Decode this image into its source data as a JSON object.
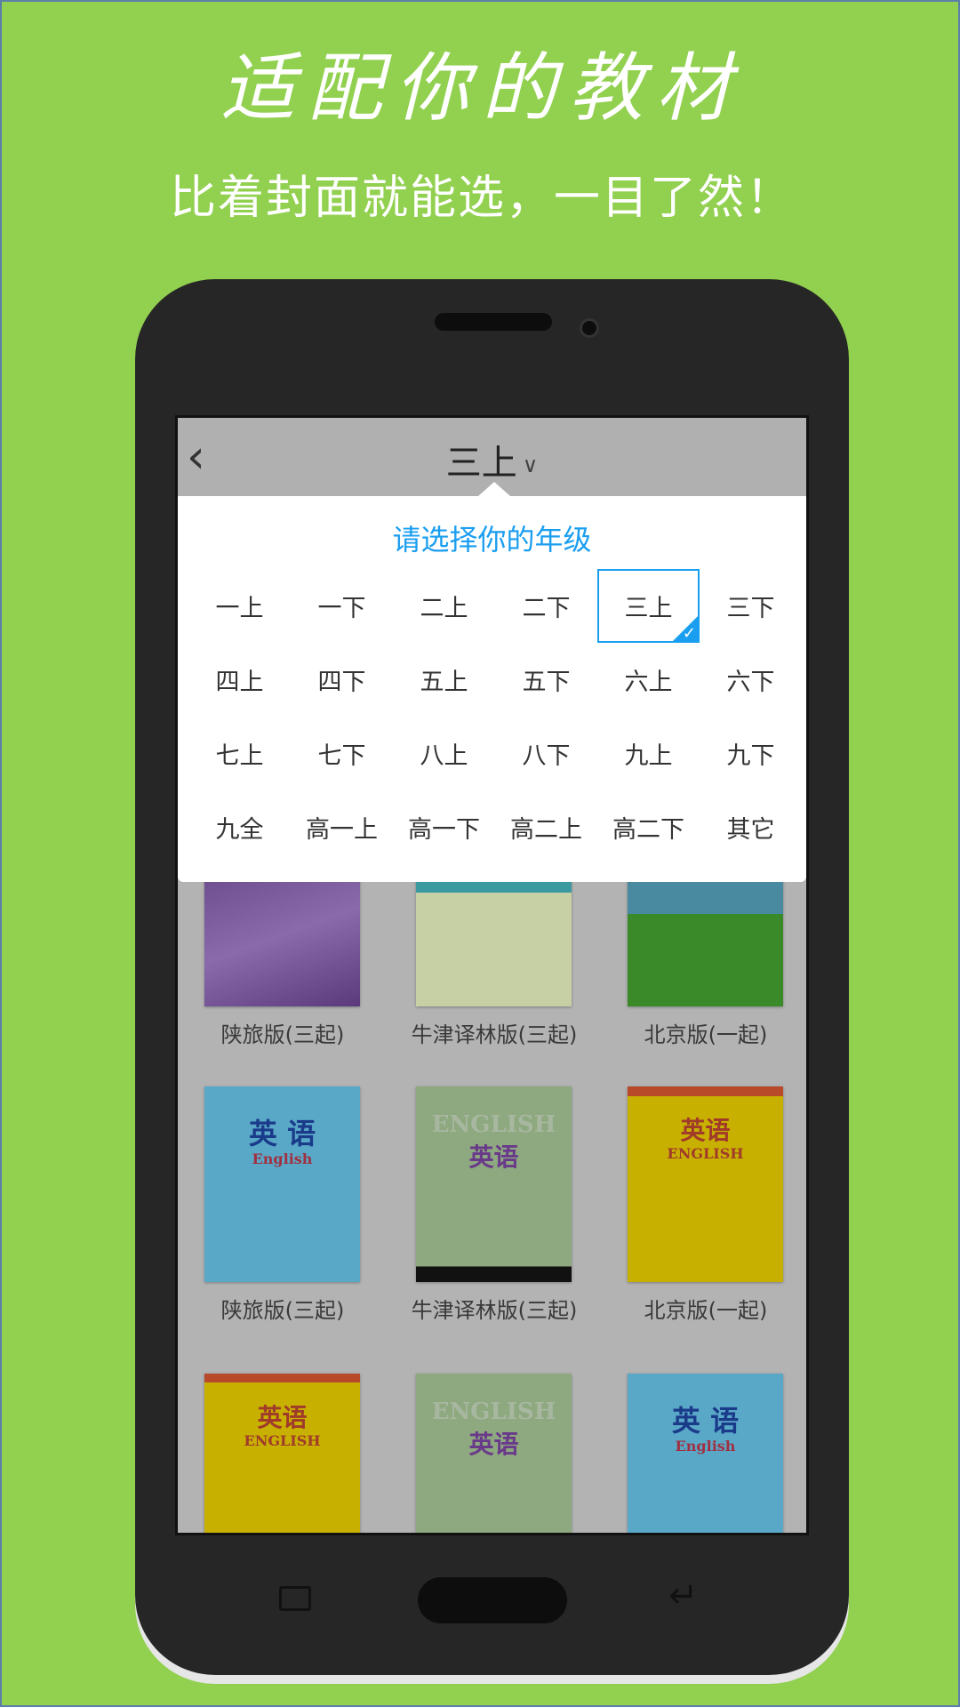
{
  "headline": "适配你的教材",
  "subheadline": "比着封面就能选，一目了然！",
  "app": {
    "back_icon": "chevron-left-icon",
    "current_grade": "三上",
    "dropdown_icon": "chevron-down-icon",
    "panel_title": "请选择你的年级",
    "accent_color": "#1a9ef0",
    "grades": [
      "一上",
      "一下",
      "二上",
      "二下",
      "三上",
      "三下",
      "四上",
      "四下",
      "五上",
      "五下",
      "六上",
      "六下",
      "七上",
      "七下",
      "八上",
      "八下",
      "九上",
      "九下",
      "九全",
      "高一上",
      "高一下",
      "高二上",
      "高二下",
      "其它"
    ],
    "selected_grade": "三上",
    "books": [
      {
        "label": "陕旅版(三起)"
      },
      {
        "label": "牛津译林版(三起)"
      },
      {
        "label": "北京版(一起)"
      },
      {
        "label": "陕旅版(三起)",
        "cover_text": "英 语",
        "cover_sub": "English"
      },
      {
        "label": "牛津译林版(三起)",
        "cover_text": "英语",
        "cover_sub": "ENGLISH"
      },
      {
        "label": "北京版(一起)",
        "cover_text": "英语",
        "cover_sub": "ENGLISH"
      },
      {
        "cover_text": "英语",
        "cover_sub": "ENGLISH"
      },
      {
        "cover_text": "英语",
        "cover_sub": "ENGLISH"
      },
      {
        "cover_text": "英 语",
        "cover_sub": "English"
      }
    ]
  }
}
